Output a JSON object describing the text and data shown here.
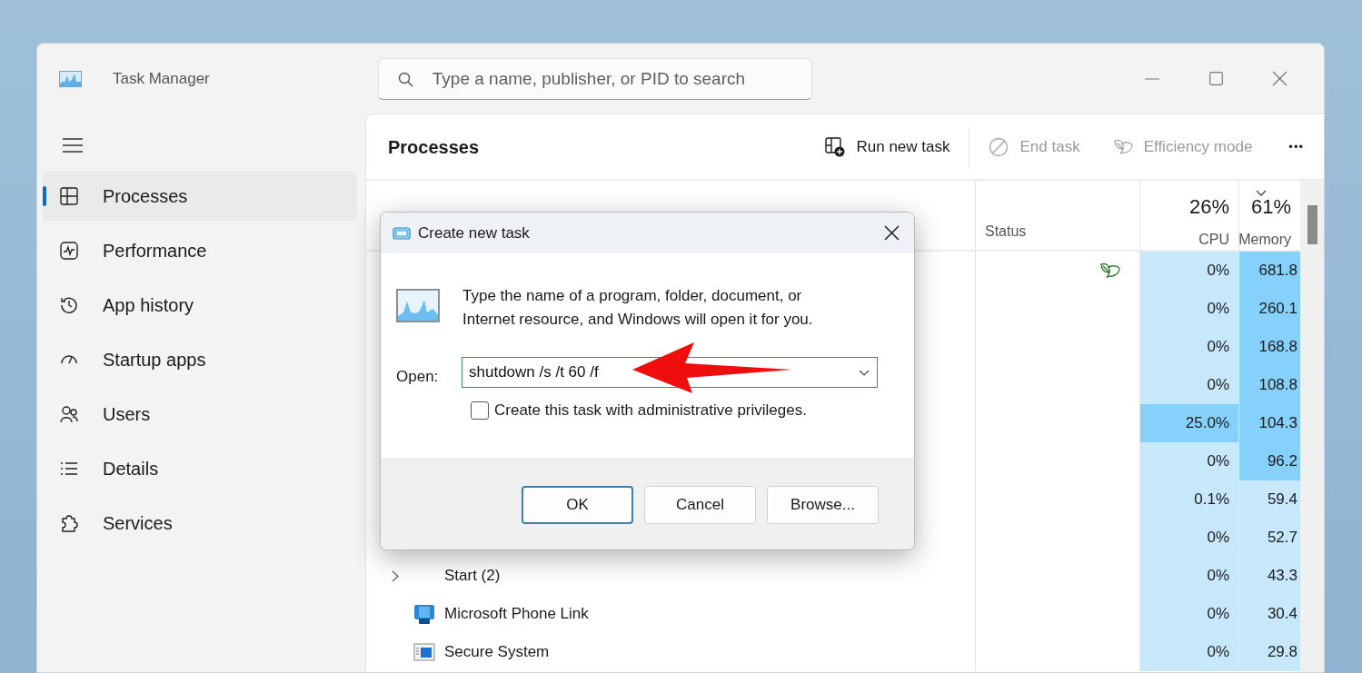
{
  "window": {
    "title": "Task Manager",
    "search_placeholder": "Type a name, publisher, or PID to search"
  },
  "sidebar": {
    "items": [
      {
        "label": "Processes",
        "selected": true
      },
      {
        "label": "Performance",
        "selected": false
      },
      {
        "label": "App history",
        "selected": false
      },
      {
        "label": "Startup apps",
        "selected": false
      },
      {
        "label": "Users",
        "selected": false
      },
      {
        "label": "Details",
        "selected": false
      },
      {
        "label": "Services",
        "selected": false
      }
    ]
  },
  "toolbar": {
    "title": "Processes",
    "actions": [
      {
        "label": "Run new task",
        "disabled": false
      },
      {
        "label": "End task",
        "disabled": true
      },
      {
        "label": "Efficiency mode",
        "disabled": true
      }
    ],
    "more": "•••"
  },
  "table": {
    "columns": [
      {
        "label": "Status"
      },
      {
        "label": "CPU",
        "total": "26%",
        "sorted": false
      },
      {
        "label": "Memory",
        "total": "61%",
        "sorted": true
      }
    ],
    "rows": [
      {
        "efficiency_mode": true,
        "cpu": "0%",
        "cpu_high": false,
        "memory": "681.8",
        "memory_high": true
      },
      {
        "efficiency_mode": false,
        "cpu": "0%",
        "cpu_high": false,
        "memory": "260.1",
        "memory_high": true
      },
      {
        "efficiency_mode": false,
        "cpu": "0%",
        "cpu_high": false,
        "memory": "168.8",
        "memory_high": true
      },
      {
        "efficiency_mode": false,
        "cpu": "0%",
        "cpu_high": false,
        "memory": "108.8",
        "memory_high": true
      },
      {
        "efficiency_mode": false,
        "cpu": "25.0%",
        "cpu_high": true,
        "memory": "104.3",
        "memory_high": true
      },
      {
        "efficiency_mode": false,
        "cpu": "0%",
        "cpu_high": false,
        "memory": "96.2",
        "memory_high": true
      },
      {
        "efficiency_mode": false,
        "cpu": "0.1%",
        "cpu_high": false,
        "memory": "59.4",
        "memory_high": false
      },
      {
        "efficiency_mode": false,
        "cpu": "0%",
        "cpu_high": false,
        "memory": "52.7",
        "memory_high": false
      },
      {
        "name": "Start (2)",
        "kind": "group",
        "expandable": true,
        "efficiency_mode": false,
        "cpu": "0%",
        "cpu_high": false,
        "memory": "43.3",
        "memory_high": false
      },
      {
        "name": "Microsoft Phone Link",
        "kind": "app",
        "expandable": false,
        "efficiency_mode": false,
        "cpu": "0%",
        "cpu_high": false,
        "memory": "30.4",
        "memory_high": false
      },
      {
        "name": "Secure System",
        "kind": "system",
        "expandable": false,
        "efficiency_mode": false,
        "cpu": "0%",
        "cpu_high": false,
        "memory": "29.8",
        "memory_high": false
      }
    ]
  },
  "dialog": {
    "title": "Create new task",
    "message": "Type the name of a program, folder, document, or Internet resource, and Windows will open it for you.",
    "open_label": "Open:",
    "open_value": "shutdown /s /t 60 /f",
    "admin_checkbox": {
      "label": "Create this task with administrative privileges.",
      "checked": false
    },
    "buttons": [
      {
        "label": "OK",
        "default": true
      },
      {
        "label": "Cancel",
        "default": false
      },
      {
        "label": "Browse...",
        "default": false
      }
    ]
  }
}
